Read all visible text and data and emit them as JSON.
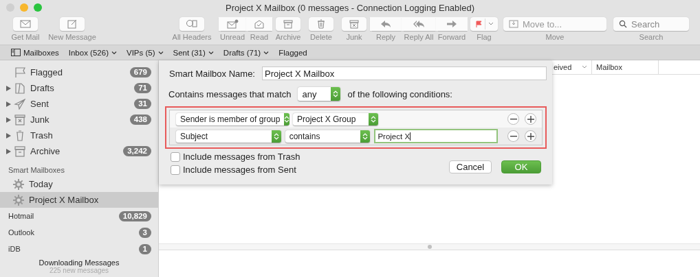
{
  "window": {
    "title": "Project X Mailbox (0 messages - Connection Logging Enabled)"
  },
  "toolbar": {
    "items": [
      {
        "label": "Get Mail",
        "kind": "button"
      },
      {
        "label": "New Message",
        "kind": "button"
      },
      {
        "label": "All Headers",
        "kind": "button"
      },
      {
        "label": "Unread",
        "kind": "segment"
      },
      {
        "label": "Read",
        "kind": "segment"
      },
      {
        "label": "Archive",
        "kind": "button"
      },
      {
        "label": "Delete",
        "kind": "button"
      },
      {
        "label": "Junk",
        "kind": "button"
      },
      {
        "label": "Reply",
        "kind": "segment"
      },
      {
        "label": "Reply All",
        "kind": "segment"
      },
      {
        "label": "Forward",
        "kind": "segment"
      },
      {
        "label": "Flag",
        "kind": "flag"
      },
      {
        "label": "Move",
        "kind": "move",
        "placeholder": "Move to..."
      },
      {
        "label": "Search",
        "kind": "search",
        "placeholder": "Search"
      }
    ]
  },
  "favorites_bar": {
    "items": [
      {
        "label": "Mailboxes",
        "menu": false
      },
      {
        "label": "Inbox (526)",
        "menu": true
      },
      {
        "label": "VIPs (5)",
        "menu": true
      },
      {
        "label": "Sent (31)",
        "menu": true
      },
      {
        "label": "Drafts (71)",
        "menu": true
      },
      {
        "label": "Flagged",
        "menu": false
      }
    ]
  },
  "sidebar": {
    "mailboxes": [
      {
        "name": "Flagged",
        "count": "679",
        "expandable": false
      },
      {
        "name": "Drafts",
        "count": "71",
        "expandable": true
      },
      {
        "name": "Sent",
        "count": "31",
        "expandable": true
      },
      {
        "name": "Junk",
        "count": "438",
        "expandable": true
      },
      {
        "name": "Trash",
        "expandable": true
      },
      {
        "name": "Archive",
        "count": "3,242",
        "expandable": true
      }
    ],
    "smart_section": "Smart Mailboxes",
    "smart_mailboxes": [
      {
        "name": "Today",
        "selected": false
      },
      {
        "name": "Project X Mailbox",
        "selected": true
      }
    ],
    "accounts": [
      {
        "name": "Hotmail",
        "count": "10,829"
      },
      {
        "name": "Outlook",
        "count": "3"
      },
      {
        "name": "iDB",
        "count": "1"
      }
    ],
    "activity": {
      "title": "Downloading Messages",
      "detail": "225 new messages"
    }
  },
  "message_list": {
    "columns": [
      {
        "label": "eived",
        "sorted": true
      },
      {
        "label": "Mailbox",
        "sorted": false
      }
    ]
  },
  "sheet": {
    "name_label": "Smart Mailbox Name:",
    "name_value": "Project X Mailbox",
    "match_prefix": "Contains messages that match",
    "match_value": "any",
    "match_suffix": "of the following conditions:",
    "conditions": [
      {
        "kind": "popup",
        "field": "Sender is member of group",
        "operator": "Project X Group"
      },
      {
        "kind": "text",
        "field": "Subject",
        "operator": "contains",
        "value": "Project X"
      }
    ],
    "checkboxes": [
      {
        "label": "Include messages from Trash",
        "checked": false
      },
      {
        "label": "Include messages from Sent",
        "checked": false
      }
    ],
    "buttons": [
      {
        "label": "Cancel",
        "default": false
      },
      {
        "label": "OK",
        "default": true
      }
    ]
  }
}
